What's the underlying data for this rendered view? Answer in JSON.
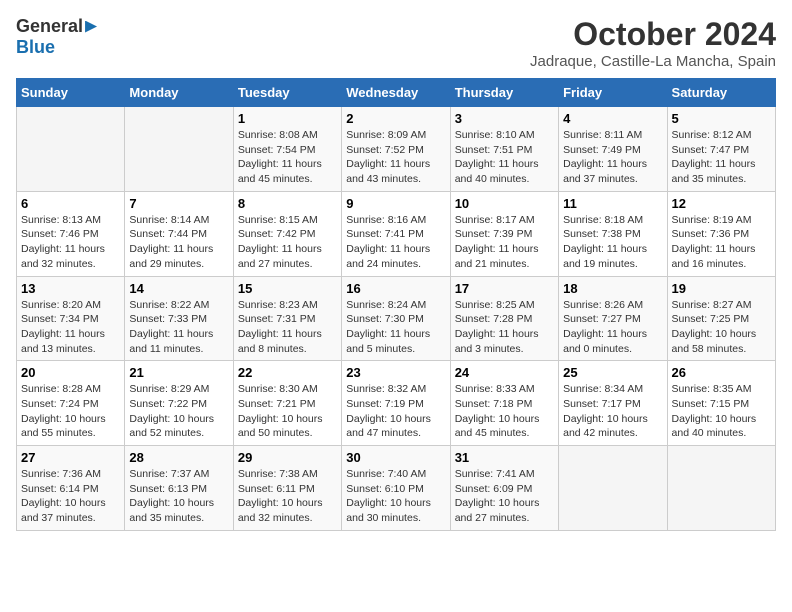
{
  "header": {
    "logo_general": "General",
    "logo_blue": "Blue",
    "month": "October 2024",
    "location": "Jadraque, Castille-La Mancha, Spain"
  },
  "weekdays": [
    "Sunday",
    "Monday",
    "Tuesday",
    "Wednesday",
    "Thursday",
    "Friday",
    "Saturday"
  ],
  "weeks": [
    [
      {
        "day": "",
        "info": ""
      },
      {
        "day": "",
        "info": ""
      },
      {
        "day": "1",
        "info": "Sunrise: 8:08 AM\nSunset: 7:54 PM\nDaylight: 11 hours and 45 minutes."
      },
      {
        "day": "2",
        "info": "Sunrise: 8:09 AM\nSunset: 7:52 PM\nDaylight: 11 hours and 43 minutes."
      },
      {
        "day": "3",
        "info": "Sunrise: 8:10 AM\nSunset: 7:51 PM\nDaylight: 11 hours and 40 minutes."
      },
      {
        "day": "4",
        "info": "Sunrise: 8:11 AM\nSunset: 7:49 PM\nDaylight: 11 hours and 37 minutes."
      },
      {
        "day": "5",
        "info": "Sunrise: 8:12 AM\nSunset: 7:47 PM\nDaylight: 11 hours and 35 minutes."
      }
    ],
    [
      {
        "day": "6",
        "info": "Sunrise: 8:13 AM\nSunset: 7:46 PM\nDaylight: 11 hours and 32 minutes."
      },
      {
        "day": "7",
        "info": "Sunrise: 8:14 AM\nSunset: 7:44 PM\nDaylight: 11 hours and 29 minutes."
      },
      {
        "day": "8",
        "info": "Sunrise: 8:15 AM\nSunset: 7:42 PM\nDaylight: 11 hours and 27 minutes."
      },
      {
        "day": "9",
        "info": "Sunrise: 8:16 AM\nSunset: 7:41 PM\nDaylight: 11 hours and 24 minutes."
      },
      {
        "day": "10",
        "info": "Sunrise: 8:17 AM\nSunset: 7:39 PM\nDaylight: 11 hours and 21 minutes."
      },
      {
        "day": "11",
        "info": "Sunrise: 8:18 AM\nSunset: 7:38 PM\nDaylight: 11 hours and 19 minutes."
      },
      {
        "day": "12",
        "info": "Sunrise: 8:19 AM\nSunset: 7:36 PM\nDaylight: 11 hours and 16 minutes."
      }
    ],
    [
      {
        "day": "13",
        "info": "Sunrise: 8:20 AM\nSunset: 7:34 PM\nDaylight: 11 hours and 13 minutes."
      },
      {
        "day": "14",
        "info": "Sunrise: 8:22 AM\nSunset: 7:33 PM\nDaylight: 11 hours and 11 minutes."
      },
      {
        "day": "15",
        "info": "Sunrise: 8:23 AM\nSunset: 7:31 PM\nDaylight: 11 hours and 8 minutes."
      },
      {
        "day": "16",
        "info": "Sunrise: 8:24 AM\nSunset: 7:30 PM\nDaylight: 11 hours and 5 minutes."
      },
      {
        "day": "17",
        "info": "Sunrise: 8:25 AM\nSunset: 7:28 PM\nDaylight: 11 hours and 3 minutes."
      },
      {
        "day": "18",
        "info": "Sunrise: 8:26 AM\nSunset: 7:27 PM\nDaylight: 11 hours and 0 minutes."
      },
      {
        "day": "19",
        "info": "Sunrise: 8:27 AM\nSunset: 7:25 PM\nDaylight: 10 hours and 58 minutes."
      }
    ],
    [
      {
        "day": "20",
        "info": "Sunrise: 8:28 AM\nSunset: 7:24 PM\nDaylight: 10 hours and 55 minutes."
      },
      {
        "day": "21",
        "info": "Sunrise: 8:29 AM\nSunset: 7:22 PM\nDaylight: 10 hours and 52 minutes."
      },
      {
        "day": "22",
        "info": "Sunrise: 8:30 AM\nSunset: 7:21 PM\nDaylight: 10 hours and 50 minutes."
      },
      {
        "day": "23",
        "info": "Sunrise: 8:32 AM\nSunset: 7:19 PM\nDaylight: 10 hours and 47 minutes."
      },
      {
        "day": "24",
        "info": "Sunrise: 8:33 AM\nSunset: 7:18 PM\nDaylight: 10 hours and 45 minutes."
      },
      {
        "day": "25",
        "info": "Sunrise: 8:34 AM\nSunset: 7:17 PM\nDaylight: 10 hours and 42 minutes."
      },
      {
        "day": "26",
        "info": "Sunrise: 8:35 AM\nSunset: 7:15 PM\nDaylight: 10 hours and 40 minutes."
      }
    ],
    [
      {
        "day": "27",
        "info": "Sunrise: 7:36 AM\nSunset: 6:14 PM\nDaylight: 10 hours and 37 minutes."
      },
      {
        "day": "28",
        "info": "Sunrise: 7:37 AM\nSunset: 6:13 PM\nDaylight: 10 hours and 35 minutes."
      },
      {
        "day": "29",
        "info": "Sunrise: 7:38 AM\nSunset: 6:11 PM\nDaylight: 10 hours and 32 minutes."
      },
      {
        "day": "30",
        "info": "Sunrise: 7:40 AM\nSunset: 6:10 PM\nDaylight: 10 hours and 30 minutes."
      },
      {
        "day": "31",
        "info": "Sunrise: 7:41 AM\nSunset: 6:09 PM\nDaylight: 10 hours and 27 minutes."
      },
      {
        "day": "",
        "info": ""
      },
      {
        "day": "",
        "info": ""
      }
    ]
  ]
}
